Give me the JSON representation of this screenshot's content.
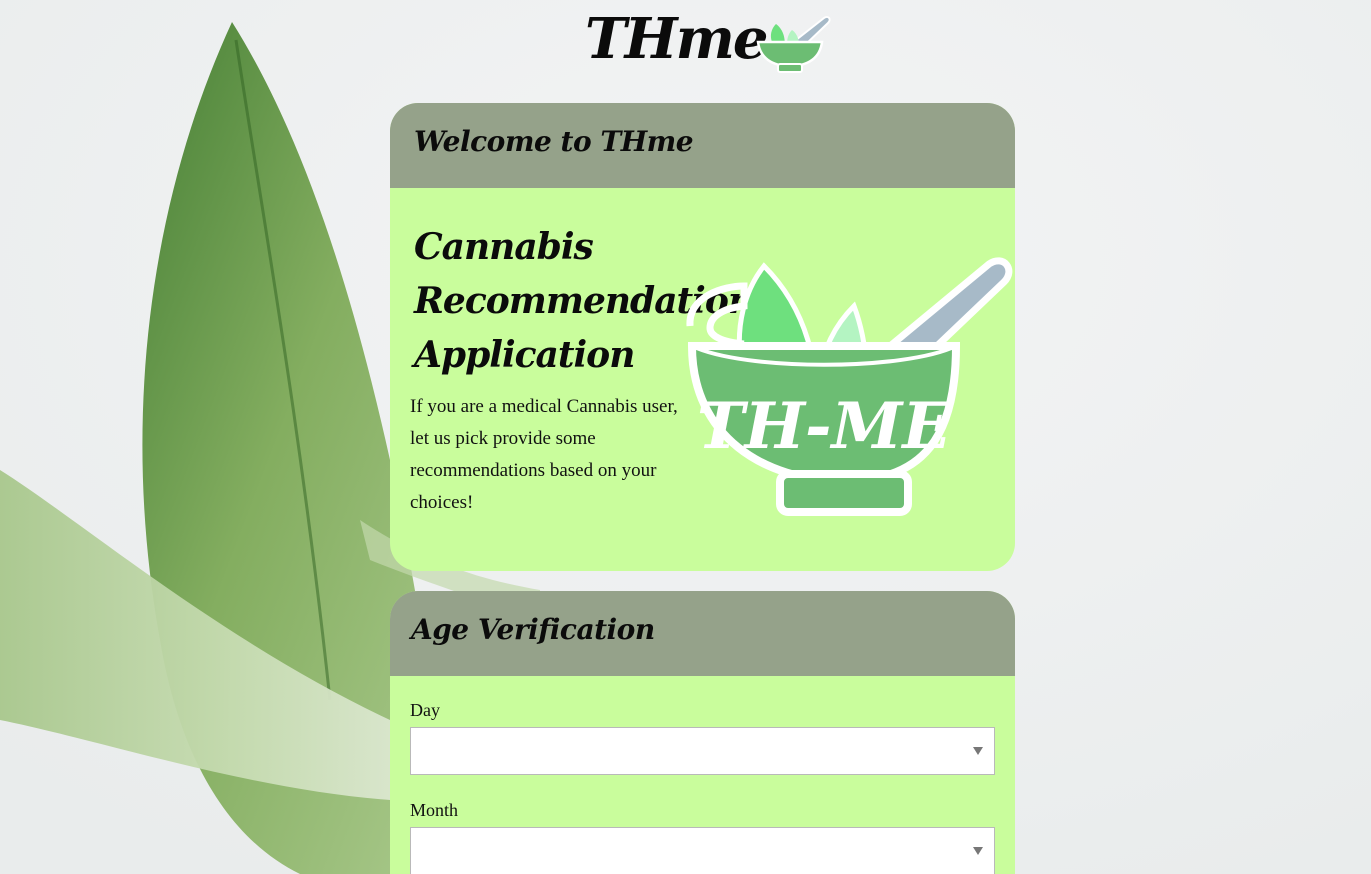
{
  "site": {
    "title": "THme"
  },
  "welcome_card": {
    "header": "Welcome to THme",
    "heading_lines": [
      "Cannabis",
      "Recommendation",
      "Application"
    ],
    "intro": "If you are a medical Cannabis user, let us pick provide some recommendations based on your choices!",
    "logo_text": "TH-ME"
  },
  "age_card": {
    "header": "Age Verification",
    "fields": [
      {
        "label": "Day",
        "value": ""
      },
      {
        "label": "Month",
        "value": ""
      }
    ]
  },
  "colors": {
    "card_header": "#95a28a",
    "card_body": "#c9fd9c",
    "leaf_dark": "#6a9a4c",
    "leaf_light": "#b9d49a",
    "logo_bowl": "#6cbd73",
    "logo_pestle": "#a7bac8"
  },
  "icons": {
    "header_logo": "mortar-pestle-icon",
    "select_arrow": "caret-down-icon"
  }
}
